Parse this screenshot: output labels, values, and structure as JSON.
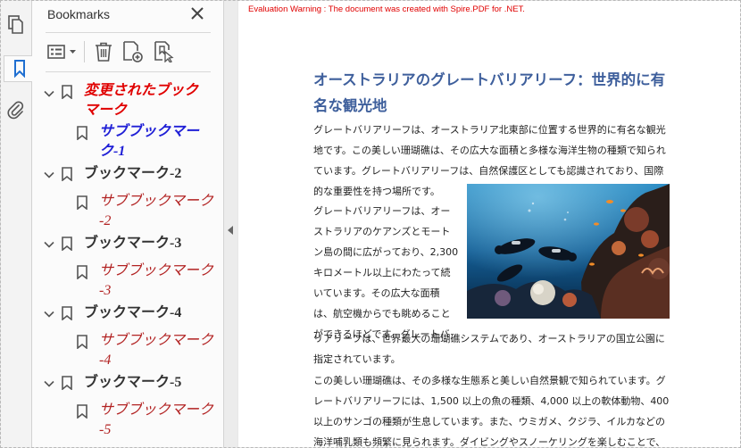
{
  "sidebar_rail": {
    "icons": [
      "pages-icon",
      "bookmark-icon",
      "attachment-icon"
    ]
  },
  "bookmarks_panel": {
    "title": "Bookmarks",
    "toolbar": [
      "options-menu-icon",
      "delete-icon",
      "new-bookmark-icon",
      "bookmark-from-selection-icon"
    ],
    "items": [
      {
        "label": "変更されたブック\nマーク",
        "child": "サブブックマー\nク-1"
      },
      {
        "label": "ブックマーク-2",
        "child": "サブブックマーク\n-2"
      },
      {
        "label": "ブックマーク-3",
        "child": "サブブックマーク\n-3"
      },
      {
        "label": "ブックマーク-4",
        "child": "サブブックマーク\n-4"
      },
      {
        "label": "ブックマーク-5",
        "child": "サブブックマーク\n-5"
      }
    ]
  },
  "document": {
    "warning": "Evaluation Warning : The document was created with Spire.PDF for .NET.",
    "heading_lines": [
      "オーストラリアのグレートバリアリーフ：世界的に有",
      "名な観光地"
    ],
    "para1_lines": [
      "グレートバリアリーフは、オーストラリア北東部に位置する世界的に有名な観光",
      "地です。この美しい珊瑚礁は、その広大な面積と多様な海洋生物の種類で知られ",
      "ています。グレートバリアリーフは、自然保護区としても認識されており、国際",
      "的な重要性を持つ場所です。"
    ],
    "para2_lines": [
      "グレートバリアリーフは、オー",
      "ストラリアのケアンズとモート",
      "ン島の間に広がっており、2,300",
      "キロメートル以上にわたって続",
      "いています。その広大な面積",
      "は、航空機からでも眺めること",
      "ができるほどです。グレートバ"
    ],
    "para2_tail_lines": [
      "リアリーフは、世界最大の珊瑚礁システムであり、オーストラリアの国立公園に",
      "指定されています。"
    ],
    "para3_lines": [
      "この美しい珊瑚礁は、その多様な生態系と美しい自然景観で知られています。グ",
      "レートバリアリーフには、1,500 以上の魚の種類、4,000 以上の軟体動物、400",
      "以上のサンゴの種類が生息しています。また、ウミガメ、クジラ、イルカなどの",
      "海洋哺乳類も頻繁に見られます。ダイビングやスノーケリングを楽しむことで、"
    ],
    "image": "underwater-divers-coral-reef-photo"
  }
}
